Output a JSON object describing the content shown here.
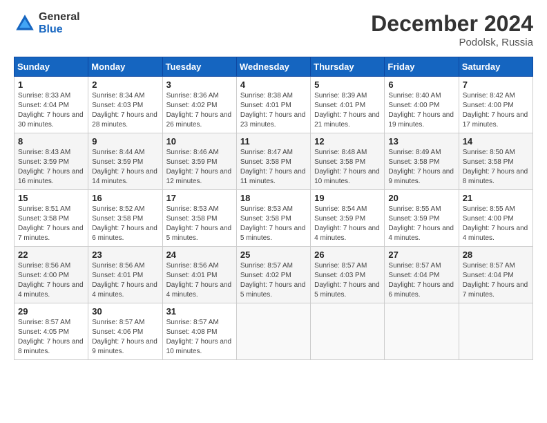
{
  "logo": {
    "general": "General",
    "blue": "Blue"
  },
  "title": "December 2024",
  "subtitle": "Podolsk, Russia",
  "days_header": [
    "Sunday",
    "Monday",
    "Tuesday",
    "Wednesday",
    "Thursday",
    "Friday",
    "Saturday"
  ],
  "weeks": [
    [
      {
        "day": "1",
        "sunrise": "8:33 AM",
        "sunset": "4:04 PM",
        "daylight": "7 hours and 30 minutes."
      },
      {
        "day": "2",
        "sunrise": "8:34 AM",
        "sunset": "4:03 PM",
        "daylight": "7 hours and 28 minutes."
      },
      {
        "day": "3",
        "sunrise": "8:36 AM",
        "sunset": "4:02 PM",
        "daylight": "7 hours and 26 minutes."
      },
      {
        "day": "4",
        "sunrise": "8:38 AM",
        "sunset": "4:01 PM",
        "daylight": "7 hours and 23 minutes."
      },
      {
        "day": "5",
        "sunrise": "8:39 AM",
        "sunset": "4:01 PM",
        "daylight": "7 hours and 21 minutes."
      },
      {
        "day": "6",
        "sunrise": "8:40 AM",
        "sunset": "4:00 PM",
        "daylight": "7 hours and 19 minutes."
      },
      {
        "day": "7",
        "sunrise": "8:42 AM",
        "sunset": "4:00 PM",
        "daylight": "7 hours and 17 minutes."
      }
    ],
    [
      {
        "day": "8",
        "sunrise": "8:43 AM",
        "sunset": "3:59 PM",
        "daylight": "7 hours and 16 minutes."
      },
      {
        "day": "9",
        "sunrise": "8:44 AM",
        "sunset": "3:59 PM",
        "daylight": "7 hours and 14 minutes."
      },
      {
        "day": "10",
        "sunrise": "8:46 AM",
        "sunset": "3:59 PM",
        "daylight": "7 hours and 12 minutes."
      },
      {
        "day": "11",
        "sunrise": "8:47 AM",
        "sunset": "3:58 PM",
        "daylight": "7 hours and 11 minutes."
      },
      {
        "day": "12",
        "sunrise": "8:48 AM",
        "sunset": "3:58 PM",
        "daylight": "7 hours and 10 minutes."
      },
      {
        "day": "13",
        "sunrise": "8:49 AM",
        "sunset": "3:58 PM",
        "daylight": "7 hours and 9 minutes."
      },
      {
        "day": "14",
        "sunrise": "8:50 AM",
        "sunset": "3:58 PM",
        "daylight": "7 hours and 8 minutes."
      }
    ],
    [
      {
        "day": "15",
        "sunrise": "8:51 AM",
        "sunset": "3:58 PM",
        "daylight": "7 hours and 7 minutes."
      },
      {
        "day": "16",
        "sunrise": "8:52 AM",
        "sunset": "3:58 PM",
        "daylight": "7 hours and 6 minutes."
      },
      {
        "day": "17",
        "sunrise": "8:53 AM",
        "sunset": "3:58 PM",
        "daylight": "7 hours and 5 minutes."
      },
      {
        "day": "18",
        "sunrise": "8:53 AM",
        "sunset": "3:58 PM",
        "daylight": "7 hours and 5 minutes."
      },
      {
        "day": "19",
        "sunrise": "8:54 AM",
        "sunset": "3:59 PM",
        "daylight": "7 hours and 4 minutes."
      },
      {
        "day": "20",
        "sunrise": "8:55 AM",
        "sunset": "3:59 PM",
        "daylight": "7 hours and 4 minutes."
      },
      {
        "day": "21",
        "sunrise": "8:55 AM",
        "sunset": "4:00 PM",
        "daylight": "7 hours and 4 minutes."
      }
    ],
    [
      {
        "day": "22",
        "sunrise": "8:56 AM",
        "sunset": "4:00 PM",
        "daylight": "7 hours and 4 minutes."
      },
      {
        "day": "23",
        "sunrise": "8:56 AM",
        "sunset": "4:01 PM",
        "daylight": "7 hours and 4 minutes."
      },
      {
        "day": "24",
        "sunrise": "8:56 AM",
        "sunset": "4:01 PM",
        "daylight": "7 hours and 4 minutes."
      },
      {
        "day": "25",
        "sunrise": "8:57 AM",
        "sunset": "4:02 PM",
        "daylight": "7 hours and 5 minutes."
      },
      {
        "day": "26",
        "sunrise": "8:57 AM",
        "sunset": "4:03 PM",
        "daylight": "7 hours and 5 minutes."
      },
      {
        "day": "27",
        "sunrise": "8:57 AM",
        "sunset": "4:04 PM",
        "daylight": "7 hours and 6 minutes."
      },
      {
        "day": "28",
        "sunrise": "8:57 AM",
        "sunset": "4:04 PM",
        "daylight": "7 hours and 7 minutes."
      }
    ],
    [
      {
        "day": "29",
        "sunrise": "8:57 AM",
        "sunset": "4:05 PM",
        "daylight": "7 hours and 8 minutes."
      },
      {
        "day": "30",
        "sunrise": "8:57 AM",
        "sunset": "4:06 PM",
        "daylight": "7 hours and 9 minutes."
      },
      {
        "day": "31",
        "sunrise": "8:57 AM",
        "sunset": "4:08 PM",
        "daylight": "7 hours and 10 minutes."
      },
      null,
      null,
      null,
      null
    ]
  ],
  "labels": {
    "sunrise": "Sunrise: ",
    "sunset": "Sunset: ",
    "daylight": "Daylight: "
  }
}
